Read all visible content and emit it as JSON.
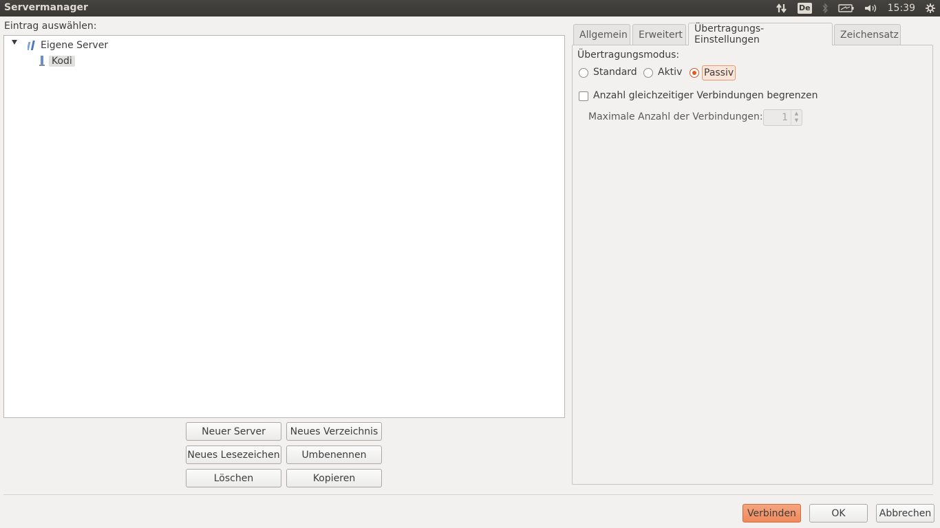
{
  "window": {
    "title": "Servermanager"
  },
  "tray": {
    "keyboard": "De",
    "clock": "15:39"
  },
  "left": {
    "select_label": "Eintrag auswählen:",
    "tree": {
      "root": "Eigene Server",
      "child": "Kodi"
    },
    "buttons": {
      "new_server": "Neuer Server",
      "new_folder": "Neues Verzeichnis",
      "new_bookmark": "Neues Lesezeichen",
      "rename": "Umbenennen",
      "delete": "Löschen",
      "copy": "Kopieren"
    }
  },
  "tabs": [
    "Allgemein",
    "Erweitert",
    "Übertragungs-Einstellungen",
    "Zeichensatz"
  ],
  "transfer": {
    "mode_label": "Übertragungsmodus:",
    "modes": [
      "Standard",
      "Aktiv",
      "Passiv"
    ],
    "selected_mode": "Passiv",
    "limit_label": "Anzahl gleichzeitiger Verbindungen begrenzen",
    "limit_checked": false,
    "max_label": "Maximale Anzahl der Verbindungen:",
    "max_value": "1"
  },
  "footer": {
    "connect": "Verbinden",
    "ok": "OK",
    "cancel": "Abbrechen"
  },
  "colors": {
    "accent": "#ef8a5c",
    "panel": "#3a3935",
    "background": "#f2f1f0"
  }
}
